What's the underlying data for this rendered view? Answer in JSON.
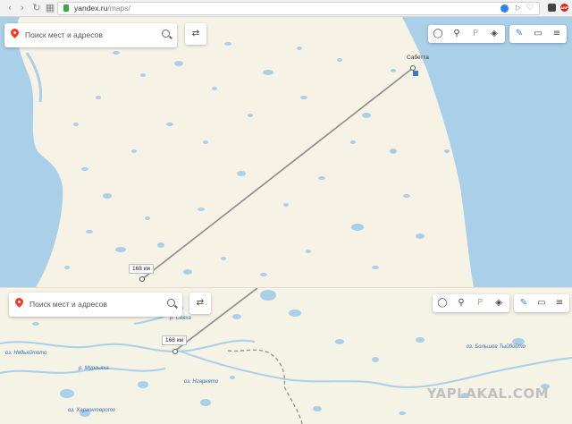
{
  "browser": {
    "url_host": "yandex.ru",
    "url_path": "/maps/",
    "extension_badge": "ABP"
  },
  "search": {
    "placeholder_top": "Поиск мест и адресов",
    "placeholder_bottom": "Поиск мест и адресов"
  },
  "map_top": {
    "place_label": "Сабетта",
    "distance_label": "168 км"
  },
  "map_bottom": {
    "distance_label": "168 км",
    "place_labels": [
      "р. Сёяха",
      "оз. Нядьяйтото",
      "р. Мургьяха",
      "оз. Нгарнято",
      "оз. Харвонтерото",
      "оз. Большое Тыйбойто"
    ]
  },
  "colors": {
    "land": "#f6f3e6",
    "water": "#a9cfe9",
    "route": "#8a8a8a",
    "pin": "#ef3b24"
  },
  "watermark": "YAPLAKAL.COM"
}
